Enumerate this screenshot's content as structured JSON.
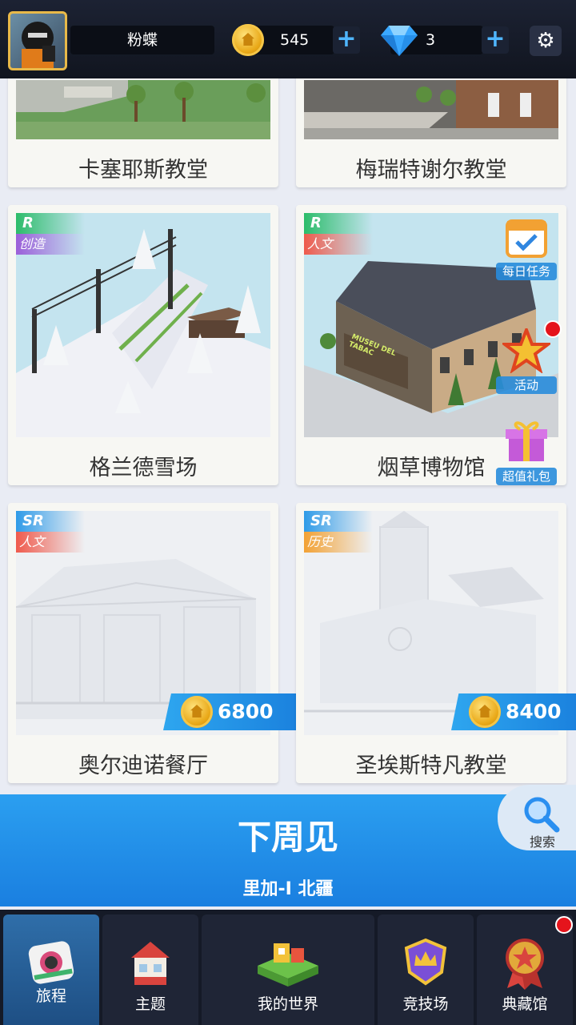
{
  "header": {
    "player_name": "粉蝶",
    "coins": "545",
    "gems": "3",
    "plus": "+",
    "settings_icon": "gear-icon"
  },
  "cards": [
    {
      "name": "卡塞耶斯教堂"
    },
    {
      "name": "梅瑞特谢尔教堂"
    },
    {
      "name": "格兰德雪场",
      "rarity": "R",
      "category": "创造"
    },
    {
      "name": "烟草博物馆",
      "rarity": "R",
      "category": "人文",
      "sign": "MUSEU DEL TABAC"
    },
    {
      "name": "奥尔迪诺餐厅",
      "rarity": "SR",
      "category": "人文",
      "price": "6800"
    },
    {
      "name": "圣埃斯特凡教堂",
      "rarity": "SR",
      "category": "历史",
      "price": "8400"
    }
  ],
  "side_badges": [
    {
      "label": "每日任务",
      "icon": "calendar-check-icon"
    },
    {
      "label": "活动",
      "icon": "star-icon"
    },
    {
      "label": "超值礼包",
      "icon": "gift-icon"
    }
  ],
  "banner": {
    "title": "下周见",
    "subtitle": "里加-I 北疆"
  },
  "search": {
    "label": "搜索"
  },
  "nav": [
    {
      "label": "旅程",
      "icon": "camera-icon",
      "active": true
    },
    {
      "label": "主题",
      "icon": "house-icon"
    },
    {
      "label": "我的世界",
      "icon": "world-blocks-icon"
    },
    {
      "label": "竞技场",
      "icon": "crown-shield-icon"
    },
    {
      "label": "典藏馆",
      "icon": "medal-icon"
    }
  ],
  "colors": {
    "accent_blue": "#1f86e2",
    "rarity_r": "#2cbc6a",
    "rarity_sr": "#2f9be8",
    "cat_create": "#9b5fd9",
    "cat_culture": "#ef5a4c",
    "cat_history": "#f2a133",
    "notify_red": "#e5141c"
  }
}
